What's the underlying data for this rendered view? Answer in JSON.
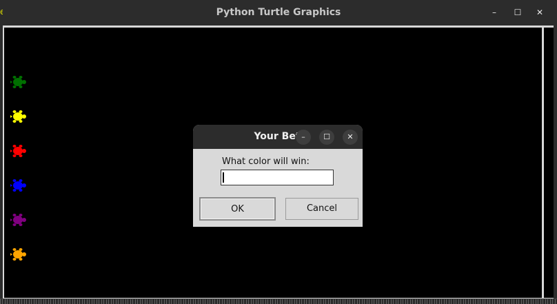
{
  "window": {
    "title": "Python Turtle Graphics",
    "controls": {
      "minimize": "–",
      "maximize": "☐",
      "close": "✕"
    }
  },
  "turtles": [
    {
      "color": "#007000"
    },
    {
      "color": "#ffff00"
    },
    {
      "color": "#ff0000"
    },
    {
      "color": "#0000ff"
    },
    {
      "color": "#800080"
    },
    {
      "color": "#ffa500"
    }
  ],
  "dialog": {
    "title": "Your Bet",
    "prompt": "What color will win:",
    "input_value": "",
    "ok_label": "OK",
    "cancel_label": "Cancel",
    "controls": {
      "minimize": "–",
      "maximize": "☐",
      "close": "✕"
    }
  }
}
